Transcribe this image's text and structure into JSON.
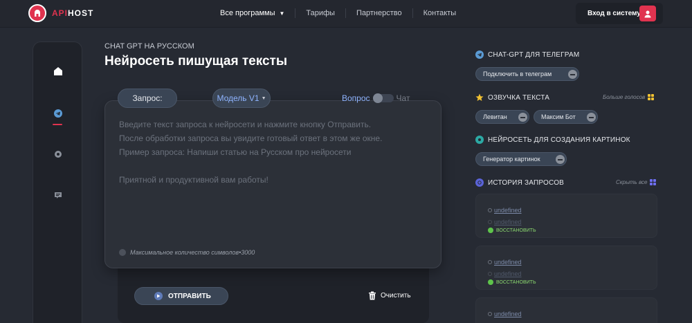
{
  "header": {
    "logo_api": "API",
    "logo_host": "HOST",
    "nav": [
      {
        "label": "Все программы"
      },
      {
        "label": "Тарифы"
      },
      {
        "label": "Партнерство"
      },
      {
        "label": "Контакты"
      }
    ],
    "login_label": "Вход в систему"
  },
  "main": {
    "eyebrow": "CHAT GPT НА РУССКОМ",
    "title": "Нейросеть пишущая тексты",
    "query_label": "Запрос:",
    "model_label": "Модель V1",
    "toggle_left": "Вопрос",
    "toggle_right": "Чат",
    "placeholder": "Введите текст запроса к нейросети и нажмите кнопку Отправить.\nПосле обработки запроса вы увидите готовый ответ в этом же окне.\nПример запроса: Напиши статью на Русском про нейросети\n\nПриятной и продуктивной вам работы!",
    "max_chars_label": "Максимальное количество символов",
    "max_chars_value": "3000",
    "send_label": "ОТПРАВИТЬ",
    "clear_label": "Очистить"
  },
  "sidebar": {
    "telegram": {
      "title": "CHAT-GPT ДЛЯ ТЕЛЕГРАМ",
      "chip": "Подключить в телеграм"
    },
    "voice": {
      "title": "ОЗВУЧКА ТЕКСТА",
      "more": "Больше голосов",
      "chips": [
        "Левитан",
        "Максим Бот"
      ]
    },
    "images": {
      "title": "НЕЙРОСЕТЬ ДЛЯ СОЗДАНИЯ КАРТИНОК",
      "chip": "Генератор картинок"
    },
    "history": {
      "title": "ИСТОРИЯ ЗАПРОСОВ",
      "hide_all": "Скрыть все",
      "items": [
        {
          "line1": "undefined",
          "line2": "undefined",
          "restore": "ВОССТАНОВИТЬ"
        },
        {
          "line1": "undefined",
          "line2": "undefined",
          "restore": "ВОССТАНОВИТЬ"
        },
        {
          "line1": "undefined"
        }
      ]
    }
  },
  "colors": {
    "accent": "#e0334f",
    "link_blue": "#8fb4ff",
    "restore_green": "#8bd96f"
  }
}
